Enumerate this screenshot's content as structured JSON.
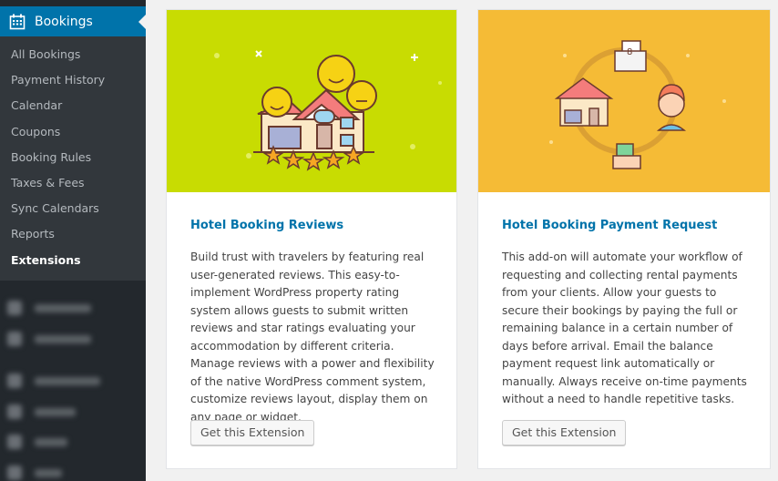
{
  "sidebar": {
    "menu_title": "Bookings",
    "menu_icon": "calendar-icon",
    "items": [
      {
        "label": "All Bookings",
        "current": false
      },
      {
        "label": "Payment History",
        "current": false
      },
      {
        "label": "Calendar",
        "current": false
      },
      {
        "label": "Coupons",
        "current": false
      },
      {
        "label": "Booking Rules",
        "current": false
      },
      {
        "label": "Taxes & Fees",
        "current": false
      },
      {
        "label": "Sync Calendars",
        "current": false
      },
      {
        "label": "Reports",
        "current": false
      },
      {
        "label": "Extensions",
        "current": true
      }
    ]
  },
  "cards": [
    {
      "title": "Hotel Booking Reviews",
      "description": "Build trust with travelers by featuring real user-generated reviews. This easy-to-implement WordPress property rating system allows guests to submit written reviews and star ratings evaluating your accommodation by different criteria. Manage reviews with a power and flexibility of the native WordPress comment system, customize reviews layout, display them on any page or widget.",
      "button_label": "Get this Extension",
      "banner_color": "#c8dc02"
    },
    {
      "title": "Hotel Booking Payment Request",
      "description": "This add-on will automate your workflow of requesting and collecting rental payments from your clients. Allow your guests to secure their bookings by paying the full or remaining balance in a certain number of days before arrival. Email the balance payment request link automatically or manually. Always receive on-time payments without a need to handle repetitive tasks.",
      "button_label": "Get this Extension",
      "banner_color": "#f5bb36"
    }
  ]
}
